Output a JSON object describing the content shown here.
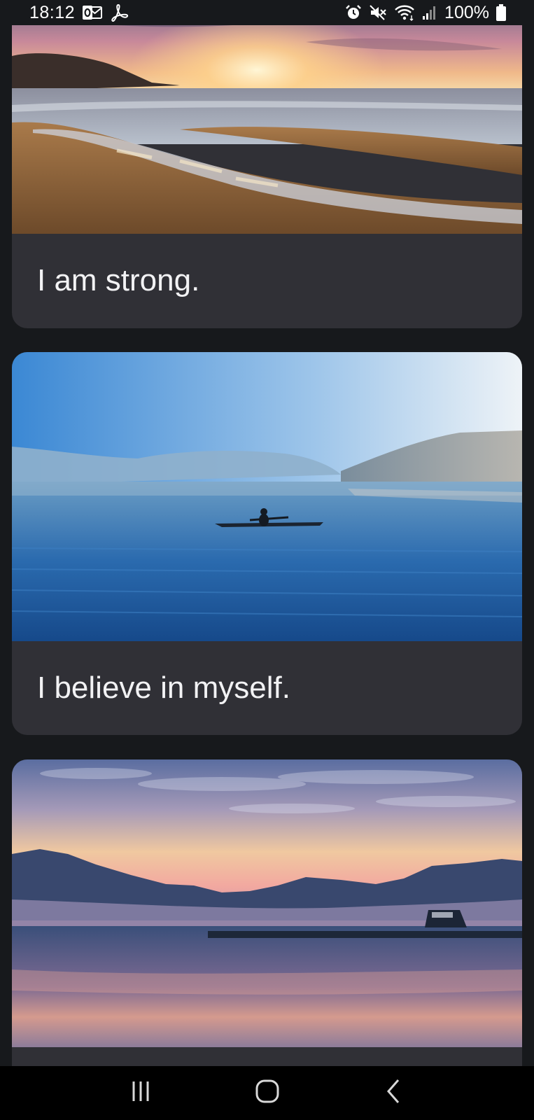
{
  "status_bar": {
    "time": "18:12",
    "battery_text": "100%",
    "left_icons": [
      "outlook-icon",
      "acrobat-icon"
    ],
    "right_icons": [
      "alarm-icon",
      "mute-icon",
      "wifi-icon",
      "signal-icon",
      "battery-icon"
    ]
  },
  "cards": [
    {
      "caption": "I am strong.",
      "image": "beach-sunset-photo"
    },
    {
      "caption": "I believe in myself.",
      "image": "lake-kayaker-photo"
    },
    {
      "caption": "",
      "image": "lake-dusk-mountains-photo"
    }
  ],
  "nav_bar": {
    "buttons": [
      "recent-apps-icon",
      "home-icon",
      "back-icon"
    ]
  },
  "colors": {
    "background": "#17191c",
    "card": "#303036",
    "caption_text": "#f2f2f4",
    "nav_bar": "#000000"
  }
}
